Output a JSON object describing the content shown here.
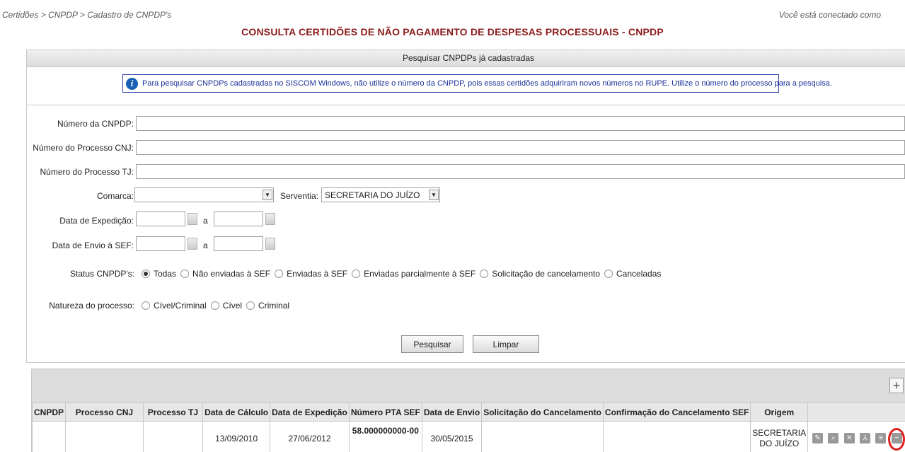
{
  "header": {
    "breadcrumb": "Certidões > CNPDP > Cadastro de CNPDP's",
    "connected": "Você está conectado como",
    "title": "CONSULTA CERTIDÕES DE NÃO PAGAMENTO DE DESPESAS PROCESSUAIS - CNPDP"
  },
  "search": {
    "panel_title": "Pesquisar CNPDPs já cadastradas",
    "info": "Para pesquisar CNPDPs cadastradas no SISCOM Windows, não utilize o número da CNPDP, pois essas certidões adquiriram novos números no RUPE. Utilize o número do processo para a pesquisa.",
    "labels": {
      "numero_cnpdp": "Número da CNPDP:",
      "numero_cnj": "Número do Processo CNJ:",
      "numero_tj": "Número do Processo TJ:",
      "comarca": "Comarca:",
      "serventia": "Serventia:",
      "data_expedicao": "Data de Expedição:",
      "data_envio": "Data de Envio à SEF:",
      "a": "a",
      "status": "Status CNPDP's:",
      "natureza": "Natureza do processo:"
    },
    "comarca_value": "",
    "serventia_value": "SECRETARIA DO JUÍZO",
    "status_options": [
      "Todas",
      "Não enviadas à SEF",
      "Enviadas à SEF",
      "Enviadas parcialmente à SEF",
      "Solicitação de cancelamento",
      "Canceladas"
    ],
    "status_selected": 0,
    "natureza_options": [
      "Cível/Criminal",
      "Cível",
      "Criminal"
    ],
    "buttons": {
      "pesquisar": "Pesquisar",
      "limpar": "Limpar"
    }
  },
  "results": {
    "add_label": "+",
    "columns": [
      "CNPDP",
      "Processo CNJ",
      "Processo TJ",
      "Data de Cálculo",
      "Data de Expedição",
      "Número PTA SEF",
      "Data de Envio",
      "Solicitação do Cancelamento",
      "Confirmação do Cancelamento SEF",
      "Origem",
      ""
    ],
    "rows": [
      {
        "cnpdp": "",
        "processo_cnj": "",
        "processo_tj": "",
        "data_calculo": "13/09/2010",
        "data_expedicao": "27/06/2012",
        "numero_pta": "58.000000000-00",
        "data_envio": "30/05/2015",
        "solicitacao": "",
        "confirmacao": "",
        "origem_1": "SECRETARIA",
        "origem_2": "DO JUÍZO"
      }
    ],
    "actions": [
      "edit-icon",
      "view-icon",
      "cancel-icon",
      "pdf-icon",
      "list-icon",
      "remove-icon"
    ]
  }
}
